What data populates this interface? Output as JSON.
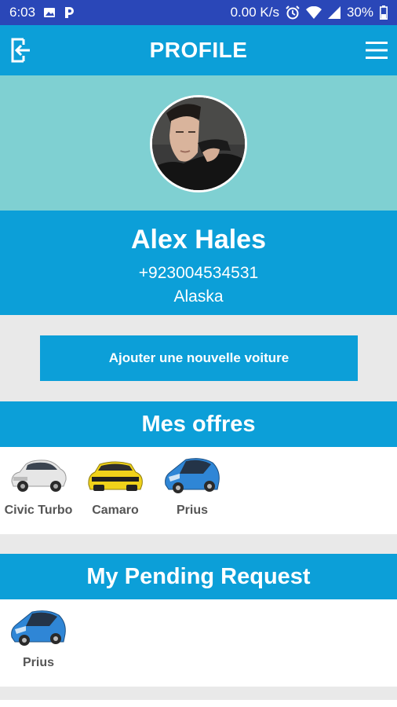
{
  "status_bar": {
    "time": "6:03",
    "network_speed": "0.00 K/s",
    "battery": "30%",
    "icons": [
      "image-icon",
      "parking-icon",
      "alarm-icon",
      "wifi-icon",
      "signal-icon",
      "battery-icon"
    ]
  },
  "app_bar": {
    "title": "PROFILE",
    "left_icon": "logout-icon",
    "right_icon": "hamburger-menu-icon"
  },
  "profile": {
    "name": "Alex Hales",
    "phone": "+923004534531",
    "location": "Alaska"
  },
  "add_car_button": {
    "label": "Ajouter une nouvelle voiture"
  },
  "offers": {
    "title": "Mes offres",
    "cars": [
      {
        "label": "Civic Turbo",
        "color": "#e6e6e6"
      },
      {
        "label": "Camaro",
        "color": "#f0d21a"
      },
      {
        "label": "Prius",
        "color": "#2f86d6"
      }
    ]
  },
  "pending": {
    "title": "My Pending Request",
    "cars": [
      {
        "label": "Prius",
        "color": "#2f86d6"
      }
    ]
  },
  "colors": {
    "primary": "#0c9fd8",
    "status_bar": "#2a47b8",
    "cover": "#7fd0d2",
    "background": "#e9e9e9"
  }
}
